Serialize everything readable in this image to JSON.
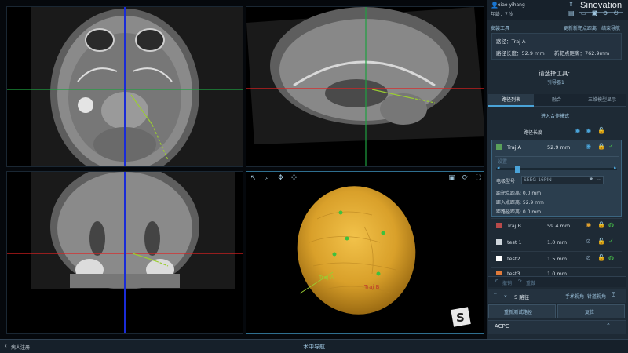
{
  "user": {
    "name": "xiao yihang",
    "age": "年龄：7 岁"
  },
  "brand": "Sinovation",
  "toolbar": {
    "install_tool": "安装工具",
    "update_target": "更新新靶点距离",
    "end_nav": "结束导航"
  },
  "traj_info": {
    "path_label": "路径：Traj A",
    "path_length": "路径长度：52.9 mm",
    "target_distance": "新靶点距离：762.9mm"
  },
  "select_tool": {
    "title": "请选择工具:",
    "subtitle": "引导器1"
  },
  "tabs": [
    "路径列表",
    "融合",
    "三维模型显示"
  ],
  "enter_mode": "进入合作模式",
  "path_length_header": "路径长度",
  "trajectories": [
    {
      "name": "Traj A",
      "length": "52.9 mm",
      "color": "#5aa05a"
    },
    {
      "name": "Traj B",
      "length": "59.4 mm",
      "color": "#b84a4a"
    },
    {
      "name": "test 1",
      "length": "1.0 mm",
      "color": "#cfd6dc"
    },
    {
      "name": "test2",
      "length": "1.5 mm",
      "color": "#ffffff"
    },
    {
      "name": "test3",
      "length": "1.0 mm",
      "color": "#e07a3a"
    }
  ],
  "traj_detail": {
    "electrode_label": "电极型号",
    "electrode_value": "SEEG-16PIN",
    "dist_target": "距靶点距离: 0.0 mm",
    "dist_entry": "距入点距离: 52.9 mm",
    "dist_path": "距路径距离: 0.0 mm",
    "set_btn": "设置",
    "slider_left": "◂",
    "slider_right": "▸"
  },
  "undo_labels": {
    "undo": "撤销",
    "redo": "重做"
  },
  "footer_paths": {
    "count": "5 路径",
    "manual_view": "手术视角",
    "vertical_view": "针道视角"
  },
  "actions": {
    "reset_test": "重新测试路径",
    "reset": "复位"
  },
  "acpc": "ACPC",
  "bottom": {
    "back": "病人注册",
    "mode": "术中导航"
  },
  "viewer_3d": {
    "label_a": "Traj A",
    "label_b": "Traj B",
    "logo_letter": "S"
  },
  "colors": {
    "crosshair_green": "#1fa040",
    "crosshair_red": "#e02020",
    "crosshair_blue": "#1a2cd8",
    "trajectory": "#9acd32",
    "brain_3d": "#d9a02a",
    "accent": "#4aa3d8"
  }
}
